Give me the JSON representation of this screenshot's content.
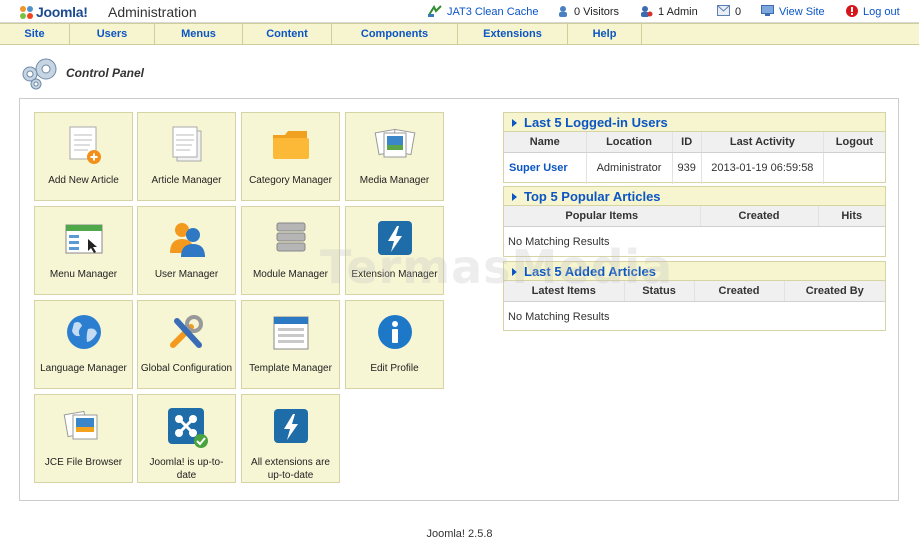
{
  "header": {
    "brand": "Joomla!",
    "title": "Administration",
    "status": [
      {
        "id": "jat3-cache",
        "label": "JAT3 Clean Cache",
        "icon": "cache-icon"
      },
      {
        "id": "visitors",
        "label": "0 Visitors",
        "icon": "visitors-icon"
      },
      {
        "id": "admins",
        "label": "1 Admin",
        "icon": "admin-user-icon"
      },
      {
        "id": "messages",
        "label": "0",
        "icon": "messages-icon"
      },
      {
        "id": "view-site",
        "label": "View Site",
        "icon": "view-site-icon"
      },
      {
        "id": "logout",
        "label": "Log out",
        "icon": "logout-icon"
      }
    ]
  },
  "menu": [
    "Site",
    "Users",
    "Menus",
    "Content",
    "Components",
    "Extensions",
    "Help"
  ],
  "page_title": "Control Panel",
  "quickicons": [
    {
      "label": "Add New Article",
      "icon": "add-article-icon"
    },
    {
      "label": "Article Manager",
      "icon": "article-manager-icon"
    },
    {
      "label": "Category Manager",
      "icon": "category-folder-icon"
    },
    {
      "label": "Media Manager",
      "icon": "media-manager-icon"
    },
    {
      "label": "Menu Manager",
      "icon": "menu-manager-icon"
    },
    {
      "label": "User Manager",
      "icon": "user-manager-icon"
    },
    {
      "label": "Module Manager",
      "icon": "module-manager-icon"
    },
    {
      "label": "Extension Manager",
      "icon": "extension-manager-icon"
    },
    {
      "label": "Language Manager",
      "icon": "language-globe-icon"
    },
    {
      "label": "Global Configuration",
      "icon": "global-config-tools-icon"
    },
    {
      "label": "Template Manager",
      "icon": "template-manager-icon"
    },
    {
      "label": "Edit Profile",
      "icon": "edit-profile-info-icon"
    },
    {
      "label": "JCE File Browser",
      "icon": "jce-file-browser-icon"
    },
    {
      "label": "Joomla! is up-to-date",
      "icon": "joomla-update-check-icon"
    },
    {
      "label": "All extensions are up-to-date",
      "icon": "extensions-update-icon"
    }
  ],
  "panels": {
    "logged_users": {
      "title": "Last 5 Logged-in Users",
      "columns": [
        "Name",
        "Location",
        "ID",
        "Last Activity",
        "Logout"
      ],
      "rows": [
        {
          "name": "Super User",
          "location": "Administrator",
          "id": "939",
          "last_activity": "2013-01-19 06:59:58",
          "logout": ""
        }
      ]
    },
    "popular": {
      "title": "Top 5 Popular Articles",
      "columns": [
        "Popular Items",
        "Created",
        "Hits"
      ],
      "empty": "No Matching Results"
    },
    "latest": {
      "title": "Last 5 Added Articles",
      "columns": [
        "Latest Items",
        "Status",
        "Created",
        "Created By"
      ],
      "empty": "No Matching Results"
    }
  },
  "footer": "Joomla! 2.5.8",
  "watermark": "TermasMedia",
  "colors": {
    "accent": "#0b55c4",
    "menubar_bg": "#f6f5cf",
    "tile_bg": "#f7f6d4",
    "border": "#d6d3a4"
  }
}
